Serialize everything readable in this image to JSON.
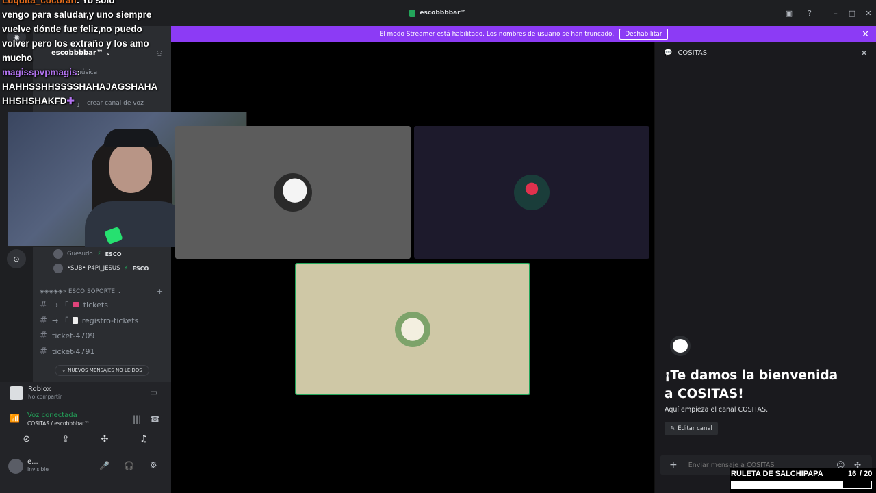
{
  "window": {
    "title": "escobbbbar™"
  },
  "banner": {
    "text": "El modo Streamer está habilitado. Los nombres de usuario se han truncado.",
    "button": "Deshabilitar"
  },
  "chat_overlay": {
    "line0_name": "Luquita_cocoran",
    "line0_rest": ": Yo solo",
    "line1": "vengo para saludar,y uno siempre",
    "line2": "vuelve dónde fue feliz,no puedo",
    "line3": "volver pero los extraño y los amo",
    "line4": "mucho",
    "line5_name": "magisspvpmagis",
    "line5_rest": ":",
    "line6": "HAHHSSHHSSSSHAHAJAGSHAHA",
    "line7": "HHSHSHAKFD"
  },
  "server": {
    "name": "escobbbbar™",
    "channel_musica": "música",
    "create_voice": "crear canal de voz",
    "members": [
      {
        "name": "Guesudo",
        "tag": "ESCO"
      },
      {
        "name": "•SUB• P4PI_JESUS",
        "tag": "ESCO"
      }
    ],
    "category": "ESCO SOPORTE",
    "category_prefix": "◈◈◈◈◈»",
    "channels": [
      {
        "name": "tickets",
        "prefix": "→ 「"
      },
      {
        "name": "registro-tickets",
        "prefix": "→ 「"
      },
      {
        "name": "ticket-4709",
        "prefix": ""
      },
      {
        "name": "ticket-4791",
        "prefix": ""
      }
    ],
    "new_messages": "NUEVOS MENSAJES NO LEÍDOS"
  },
  "activity": {
    "game": "Roblox",
    "status": "No compartir"
  },
  "voice": {
    "status": "Voz conectada",
    "location": "COSITAS / escobbbbar™"
  },
  "user": {
    "name": "e...",
    "status": "Invisible"
  },
  "right_panel": {
    "channel_name": "COSITAS",
    "welcome_title": "¡Te damos la bienvenida a COSITAS!",
    "welcome_sub": "Aquí empieza el canal COSITAS.",
    "edit_button": "Editar canal",
    "input_placeholder": "Enviar mensaje a COSITAS"
  },
  "roulette": {
    "label": "RULETA DE SALCHIPAPA",
    "current": "16",
    "total": "/ 20",
    "progress_fraction": 0.8
  },
  "colors": {
    "banner": "#8c3bf5",
    "voice_connected": "#23a55a",
    "speaking_border": "#23a55a",
    "tile1": "#5c5c5c",
    "tile2": "#1d1a2c",
    "tile3": "#cfc8a6"
  }
}
